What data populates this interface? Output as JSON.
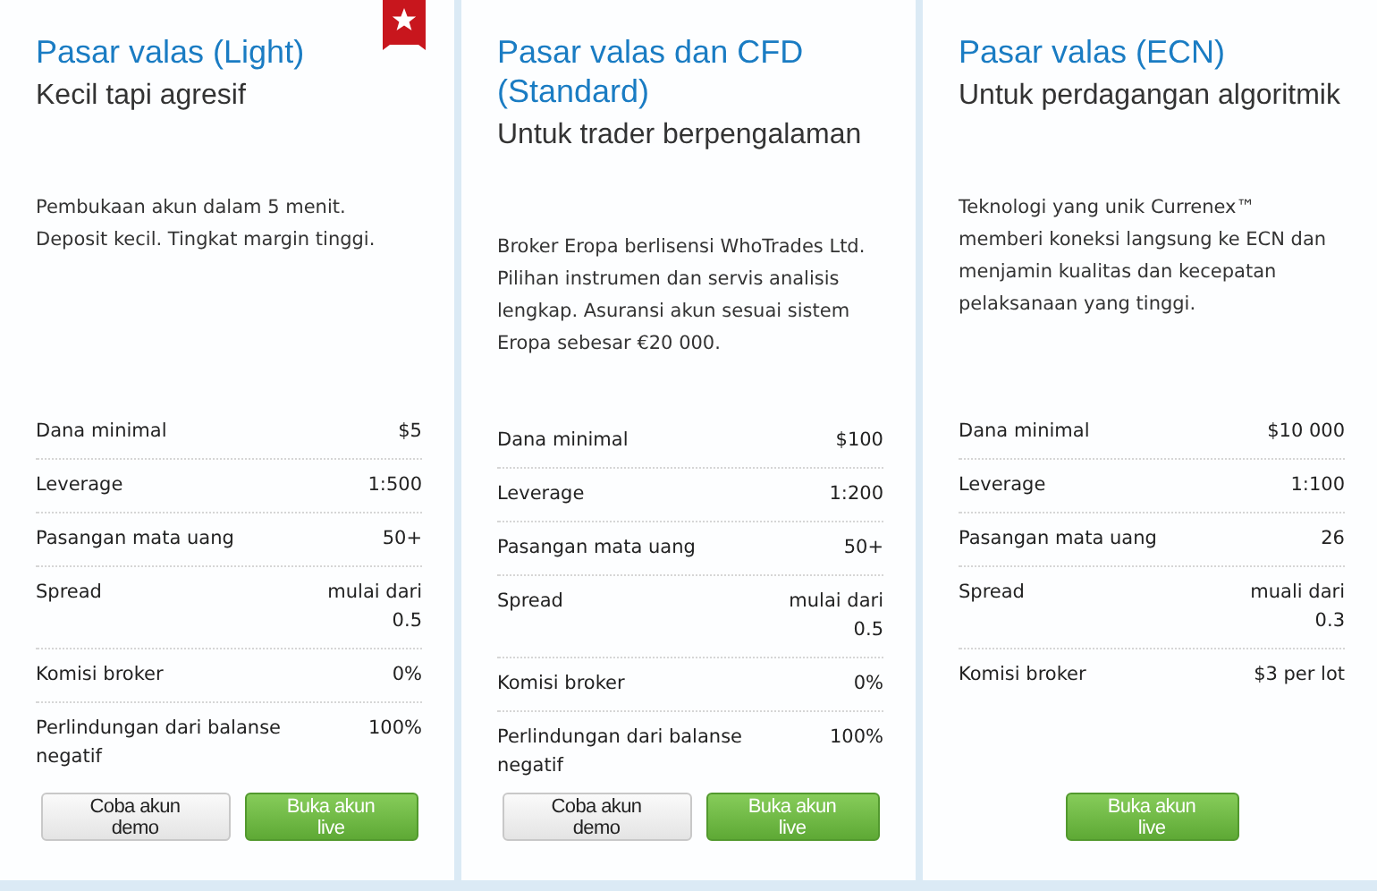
{
  "plans": [
    {
      "title": "Pasar valas (Light)",
      "subtitle": "Kecil tapi agresif",
      "featured": true,
      "description": "Pembukaan akun dalam 5 menit. Deposit kecil. Tingkat margin tinggi.",
      "specs": [
        {
          "label": "Dana minimal",
          "value": "$5"
        },
        {
          "label": "Leverage",
          "value": "1:500"
        },
        {
          "label": "Pasangan mata uang",
          "value": "50+"
        },
        {
          "label": "Spread",
          "value": "mulai dari 0.5"
        },
        {
          "label": "Komisi broker",
          "value": "0%"
        },
        {
          "label": "Perlindungan dari balanse negatif",
          "value": "100%"
        }
      ],
      "buttons": [
        {
          "label": "Coba akun demo",
          "kind": "demo"
        },
        {
          "label": "Buka akun live",
          "kind": "live"
        }
      ]
    },
    {
      "title": "Pasar valas dan CFD (Standard)",
      "subtitle": "Untuk trader berpengalaman",
      "featured": false,
      "description": "Broker Eropa berlisensi WhoTrades Ltd. Pilihan instrumen dan servis analisis lengkap. Asuransi akun sesuai sistem Eropa sebesar €20 000.",
      "specs": [
        {
          "label": "Dana minimal",
          "value": "$100"
        },
        {
          "label": "Leverage",
          "value": "1:200"
        },
        {
          "label": "Pasangan mata uang",
          "value": "50+"
        },
        {
          "label": "Spread",
          "value": "mulai dari 0.5"
        },
        {
          "label": "Komisi broker",
          "value": "0%"
        },
        {
          "label": "Perlindungan dari balanse negatif",
          "value": "100%"
        }
      ],
      "buttons": [
        {
          "label": "Coba akun demo",
          "kind": "demo"
        },
        {
          "label": "Buka akun live",
          "kind": "live"
        }
      ]
    },
    {
      "title": "Pasar valas (ECN)",
      "subtitle": "Untuk perdagangan algoritmik",
      "featured": false,
      "description": "Teknologi yang unik Currenex™ memberi koneksi langsung ke ECN dan menjamin kualitas dan kecepatan pelaksanaan yang tinggi.",
      "specs": [
        {
          "label": "Dana minimal",
          "value": "$10 000"
        },
        {
          "label": "Leverage",
          "value": "1:100"
        },
        {
          "label": "Pasangan mata uang",
          "value": "26"
        },
        {
          "label": "Spread",
          "value": "muali dari 0.3"
        },
        {
          "label": "Komisi broker",
          "value": "$3 per lot"
        }
      ],
      "buttons": [
        {
          "label": "Buka akun live",
          "kind": "live"
        }
      ]
    }
  ]
}
